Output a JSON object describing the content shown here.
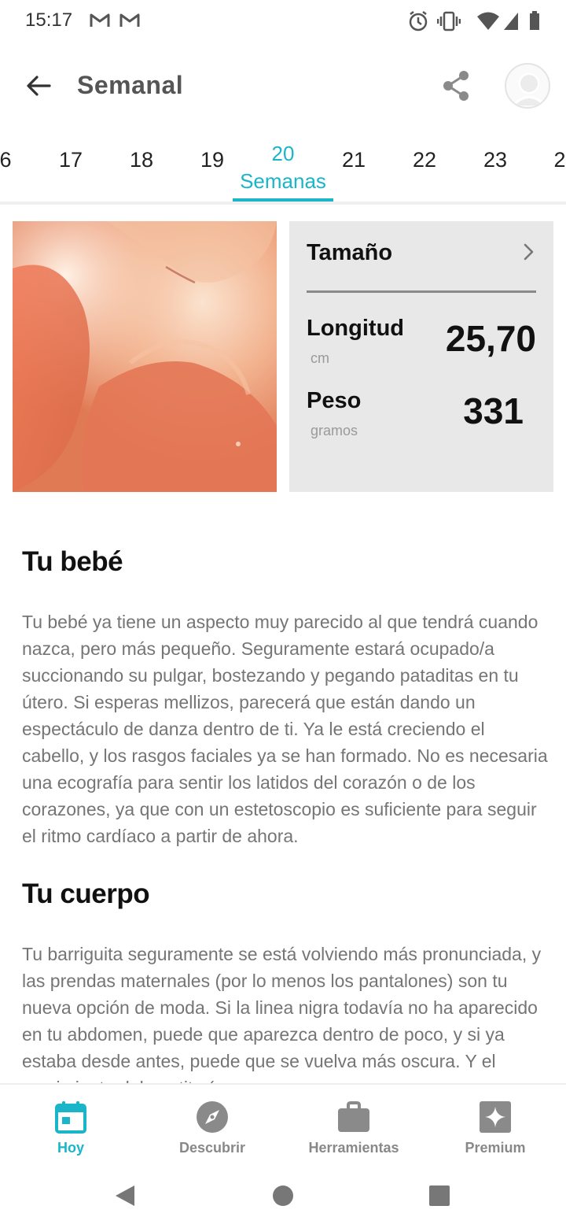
{
  "status_bar": {
    "time": "15:17",
    "icons": [
      "gmail-icon",
      "gmail-icon",
      "alarm-icon",
      "vibrate-icon",
      "wifi-icon",
      "signal-icon",
      "battery-icon"
    ]
  },
  "app_bar": {
    "title": "Semanal",
    "back_icon": "arrow-left-icon",
    "share_icon": "share-icon",
    "avatar_icon": "avatar-icon"
  },
  "week_tabs": {
    "items": [
      "6",
      "17",
      "18",
      "19",
      "20",
      "21",
      "22",
      "23",
      "2"
    ],
    "active_index": 4,
    "active_number": "20",
    "active_label": "Semanas"
  },
  "size_card": {
    "title": "Tamaño",
    "length_label": "Longitud",
    "length_unit": "cm",
    "length_value": "25,70",
    "weight_label": "Peso",
    "weight_unit": "gramos",
    "weight_value": "331"
  },
  "sections": {
    "baby_title": "Tu bebé",
    "baby_body": "Tu bebé ya tiene un aspecto muy parecido al que tendrá cuando nazca, pero más pequeño. Seguramente estará ocupado/a succionando su pulgar, bostezando y pegando pataditas en tu útero. Si esperas mellizos, parecerá que están dando un espectáculo de danza dentro de ti. Ya le está creciendo el cabello, y los rasgos faciales ya se han formado. No es necesaria una ecografía para sentir los latidos del corazón o de los corazones, ya que con un estetoscopio es suficiente para seguir el ritmo cardíaco a partir de ahora.",
    "body_title": "Tu cuerpo",
    "body_body": "Tu barriguita seguramente se está volviendo más pronunciada, y las prendas maternales (por lo menos los pantalones) son tu nueva opción de moda. Si la linea nigra todavía no ha aparecido en tu abdomen, puede que aparezca dentro de poco, y si ya estaba desde antes, puede que se vuelva más oscura. Y el crecimiento del apetito (no"
  },
  "bottom_nav": {
    "items": [
      {
        "label": "Hoy",
        "icon": "calendar-icon",
        "active": true
      },
      {
        "label": "Descubrir",
        "icon": "compass-icon",
        "active": false
      },
      {
        "label": "Herramientas",
        "icon": "briefcase-icon",
        "active": false
      },
      {
        "label": "Premium",
        "icon": "sparkle-icon",
        "active": false
      }
    ]
  },
  "system_nav": {
    "icons": [
      "back-triangle-icon",
      "home-circle-icon",
      "recents-square-icon"
    ]
  },
  "colors": {
    "accent": "#1bb5c9",
    "card_bg": "#e8e8e8",
    "body_text": "#757575",
    "nav_inactive": "#888888"
  }
}
